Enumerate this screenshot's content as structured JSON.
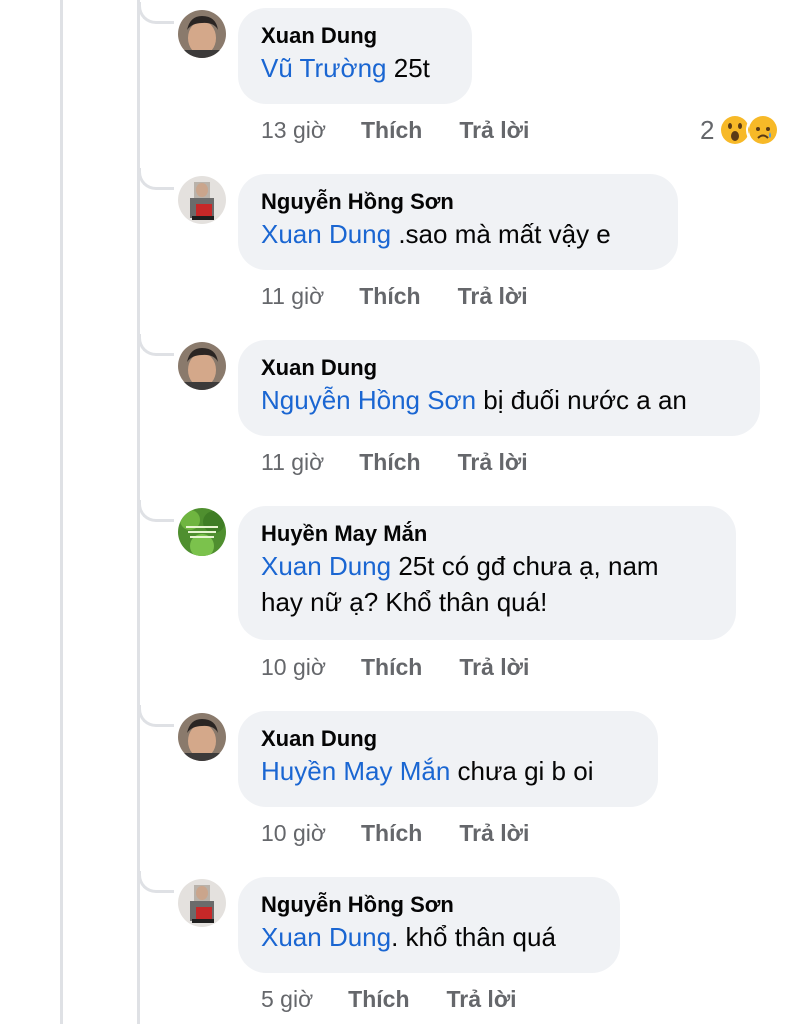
{
  "comments": [
    {
      "author": "Xuan Dung",
      "mention": "Vũ Trường",
      "text": " 25t",
      "time": "13 giờ",
      "like": "Thích",
      "reply": "Trả lời",
      "reactions": {
        "count": "2",
        "icons": [
          "wow-reaction-icon",
          "sad-reaction-icon"
        ]
      }
    },
    {
      "author": "Nguyễn Hồng Sơn",
      "mention": "Xuan Dung",
      "text": " .sao mà mất vậy e",
      "time": "11 giờ",
      "like": "Thích",
      "reply": "Trả lời"
    },
    {
      "author": "Xuan Dung",
      "mention": "Nguyễn Hồng Sơn",
      "text": " bị đuối nước a an",
      "time": "11 giờ",
      "like": "Thích",
      "reply": "Trả lời"
    },
    {
      "author": "Huyền May Mắn",
      "mention": "Xuan Dung",
      "text": " 25t có gđ chưa ạ, nam",
      "text2": "hay nữ ạ? Khổ thân quá!",
      "time": "10 giờ",
      "like": "Thích",
      "reply": "Trả lời"
    },
    {
      "author": "Xuan Dung",
      "mention": "Huyền May Mắn",
      "text": " chưa gi b oi",
      "time": "10 giờ",
      "like": "Thích",
      "reply": "Trả lời"
    },
    {
      "author": "Nguyễn Hồng Sơn",
      "mention": "Xuan Dung",
      "text": ". khổ thân quá",
      "time": "5 giờ",
      "like": "Thích",
      "reply": "Trả lời"
    }
  ],
  "colors": {
    "bubble": "#f0f2f5",
    "mention": "#1a66d2",
    "meta": "#65676b",
    "thread_line": "#dfe1e5"
  }
}
